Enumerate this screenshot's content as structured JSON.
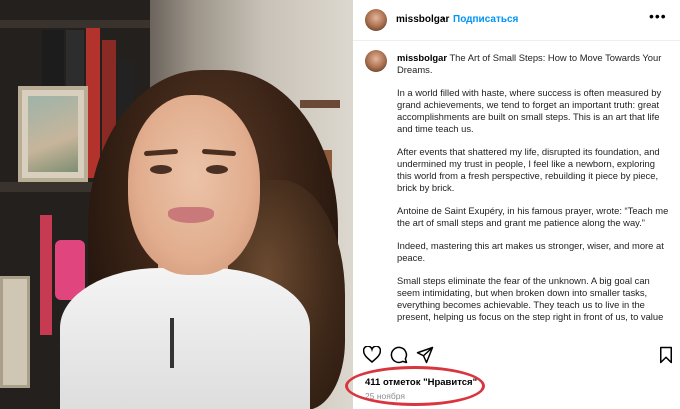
{
  "post": {
    "username": "missbolgar",
    "follow_label": "Подписаться",
    "separator": "•",
    "more": "•••"
  },
  "caption": {
    "username": "missbolgar",
    "title": "The Art of Small Steps: How to Move Towards Your Dreams.",
    "paragraphs": [
      "In a world filled with haste, where success is often measured by grand achievements, we tend to forget an important truth: great accomplishments are built on small steps. This is an art that life and time teach us.",
      "After events that shattered my life, disrupted its foundation, and undermined my trust in people, I feel like a newborn, exploring this world from a fresh perspective, rebuilding it piece by piece, brick by brick.",
      "Antoine de Saint Exupéry, in his famous prayer, wrote: “Teach me the art of small steps and grant me patience along the way.”",
      "Indeed, mastering this art makes us stronger, wiser, and more at peace.",
      "Small steps eliminate the fear of the unknown. A big goal can seem intimidating, but when broken down into smaller tasks, everything becomes achievable. They teach us to live in the present, helping us focus on the step right in front of us, to value"
    ]
  },
  "footer": {
    "likes": "411 отметок \"Нравится\"",
    "date": "25 ноября"
  },
  "icons": {
    "like": "heart-icon",
    "comment": "comment-icon",
    "share": "share-icon",
    "save": "bookmark-icon"
  },
  "colors": {
    "follow": "#0095f6",
    "highlight": "#d8353e"
  }
}
